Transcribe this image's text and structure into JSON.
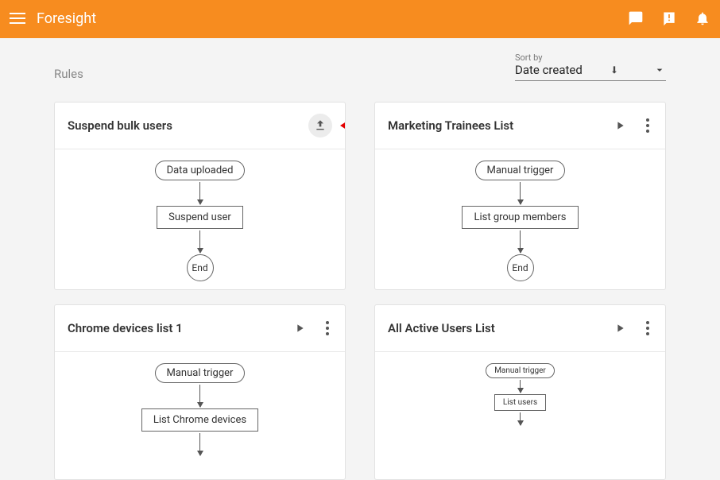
{
  "app": {
    "title": "Foresight"
  },
  "page": {
    "heading": "Rules"
  },
  "sort": {
    "label": "Sort by",
    "value": "Date created"
  },
  "cards": [
    {
      "title": "Suspend bulk users",
      "action": "upload",
      "annotate": true,
      "flow": {
        "trigger": "Data uploaded",
        "step": "Suspend user",
        "end": "End"
      }
    },
    {
      "title": "Marketing Trainees List",
      "action": "play-menu",
      "flow": {
        "trigger": "Manual trigger",
        "step": "List group members",
        "end": "End"
      }
    },
    {
      "title": "Chrome devices list 1",
      "action": "play-menu",
      "flow": {
        "trigger": "Manual trigger",
        "step": "List Chrome devices"
      }
    },
    {
      "title": "All Active Users List",
      "action": "play-menu",
      "small": true,
      "flow": {
        "trigger": "Manual trigger",
        "step": "List users"
      }
    }
  ]
}
